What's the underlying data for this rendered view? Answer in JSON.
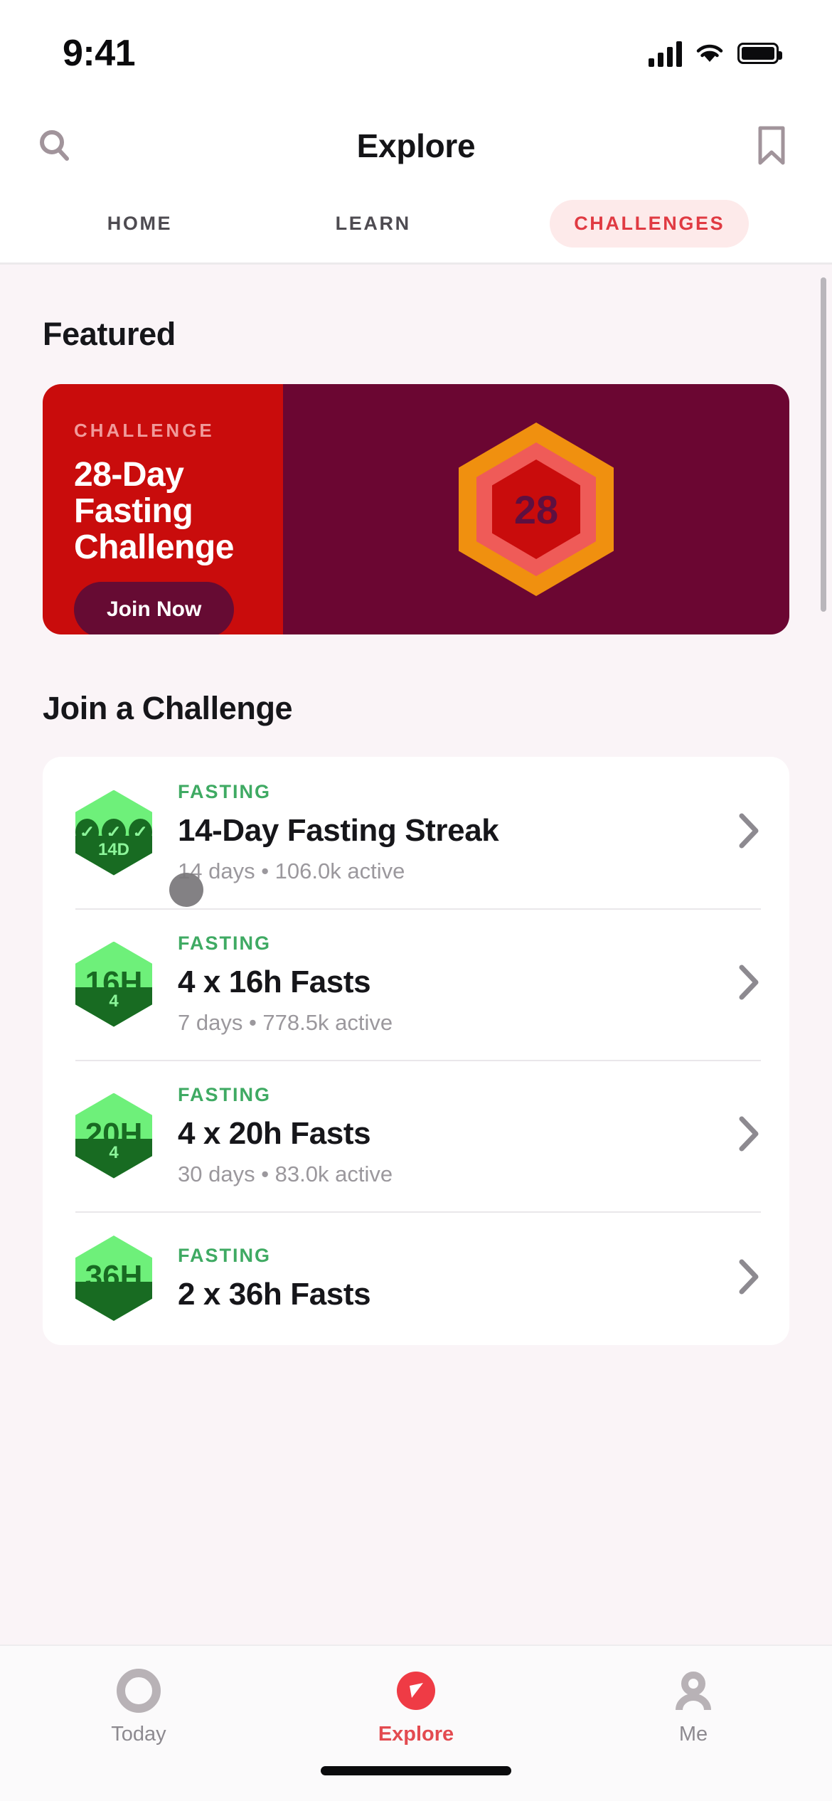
{
  "status_bar": {
    "time": "9:41",
    "cellular_icon": "signal-bars-icon",
    "wifi_icon": "wifi-icon",
    "battery_icon": "battery-full-icon"
  },
  "nav": {
    "title": "Explore",
    "search_icon": "search-icon",
    "bookmark_icon": "bookmark-icon"
  },
  "segmented_tabs": {
    "items": [
      {
        "label": "HOME",
        "active": false
      },
      {
        "label": "LEARN",
        "active": false
      },
      {
        "label": "CHALLENGES",
        "active": true
      }
    ],
    "active_color": "#e03a42",
    "active_pill_bg": "#fdeaea"
  },
  "featured": {
    "section_title": "Featured",
    "card": {
      "kicker": "CHALLENGE",
      "title": "28-Day Fasting Challenge",
      "cta_label": "Join Now",
      "badge_number": "28",
      "left_bg": "#c90c0c",
      "right_bg": "#6b0632",
      "badge_outer": "#f0900f",
      "badge_middle": "#ef5b58",
      "badge_inner": "#c90c0c",
      "badge_number_color": "#5d1040"
    }
  },
  "join_a_challenge": {
    "section_title": "Join a Challenge",
    "chevron_icon": "chevron-right-icon",
    "rows": [
      {
        "kicker": "FASTING",
        "title": "14-Day Fasting Streak",
        "meta": "14 days • 106.0k active",
        "badge_label": "14D",
        "badge_style": "checks",
        "badge_top": "#6ef07a",
        "badge_bottom": "#186b22"
      },
      {
        "kicker": "FASTING",
        "title": "4 x 16h Fasts",
        "meta": "7 days • 778.5k active",
        "badge_big": "16H",
        "badge_label": "4",
        "badge_style": "text",
        "badge_top": "#6ef07a",
        "badge_bottom": "#186b22"
      },
      {
        "kicker": "FASTING",
        "title": "4 x 20h Fasts",
        "meta": "30 days • 83.0k active",
        "badge_big": "20H",
        "badge_label": "4",
        "badge_style": "text",
        "badge_top": "#6ef07a",
        "badge_bottom": "#186b22"
      },
      {
        "kicker": "FASTING",
        "title": "2 x 36h Fasts",
        "meta": "",
        "badge_big": "36H",
        "badge_label": "",
        "badge_style": "text",
        "badge_top": "#6ef07a",
        "badge_bottom": "#186b22"
      }
    ]
  },
  "bottom_tabs": {
    "items": [
      {
        "label": "Today",
        "icon": "circle-outline-icon",
        "active": false
      },
      {
        "label": "Explore",
        "icon": "compass-icon",
        "active": true
      },
      {
        "label": "Me",
        "icon": "person-icon",
        "active": false
      }
    ],
    "active_color": "#e34b50",
    "inactive_color": "#b8b2b6"
  }
}
